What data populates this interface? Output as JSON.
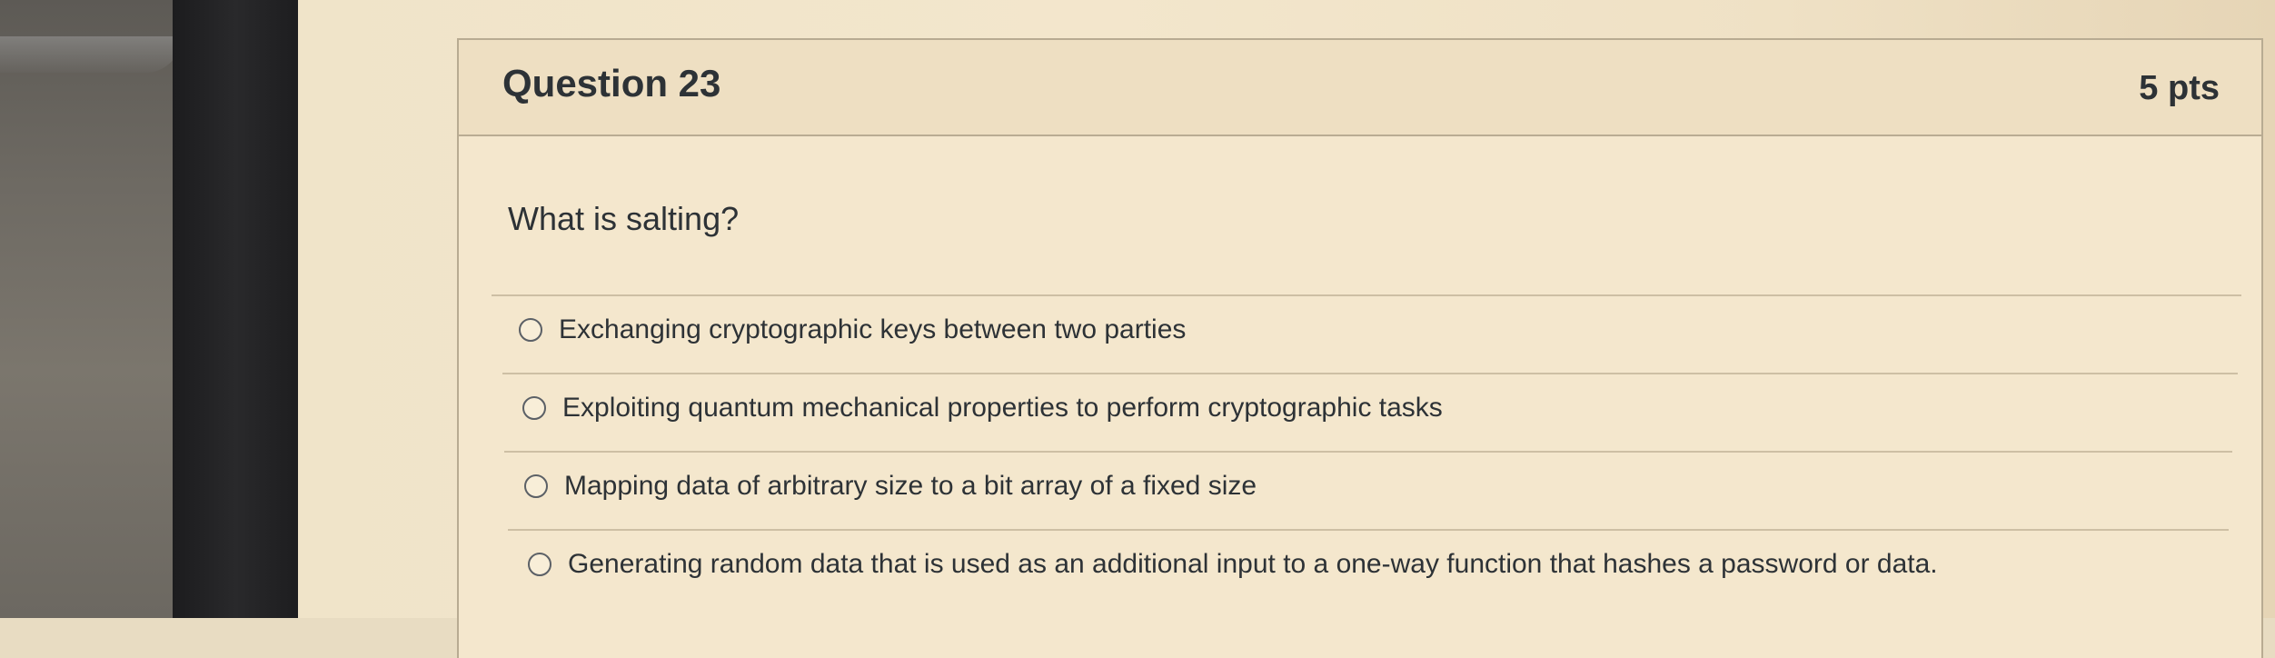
{
  "question": {
    "title": "Question 23",
    "points": "5 pts",
    "prompt": "What is salting?"
  },
  "answers": [
    {
      "label": "Exchanging cryptographic keys between two parties",
      "selected": false
    },
    {
      "label": "Exploiting quantum mechanical properties to perform cryptographic tasks",
      "selected": false
    },
    {
      "label": "Mapping data of arbitrary size to a bit array of a fixed size",
      "selected": false
    },
    {
      "label": "Generating random data that is used as an additional input to a one-way function that hashes a password or data.",
      "selected": false
    }
  ],
  "colors": {
    "text": "#2d3236",
    "card_background": "#f4e7cd",
    "header_background": "#eedfc2",
    "border": "#b8ab92"
  },
  "icons": {
    "answer_marker": "radio-button-icon"
  }
}
